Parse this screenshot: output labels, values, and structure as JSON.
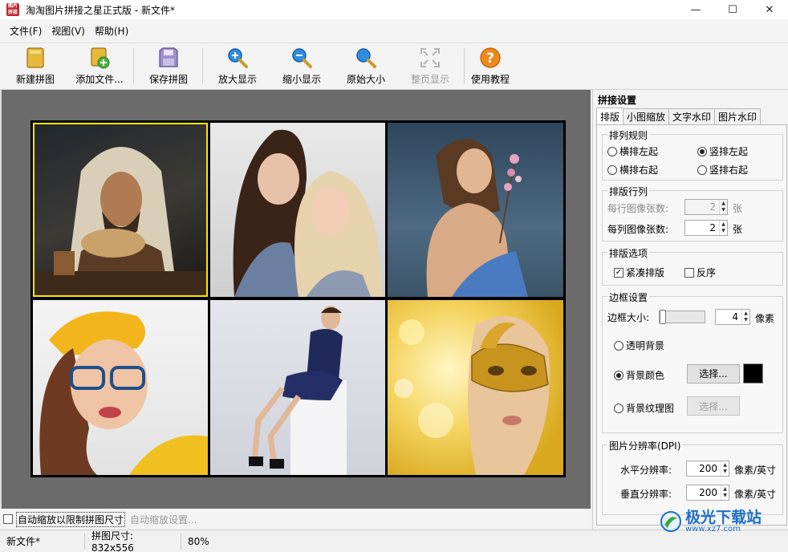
{
  "window": {
    "title": "淘淘图片拼接之星正式版 - 新文件*",
    "app_icon_text": "图片拼接",
    "minimize": "—",
    "maximize": "☐",
    "close": "✕"
  },
  "menu": [
    "文件(F)",
    "视图(V)",
    "帮助(H)"
  ],
  "toolbar": [
    {
      "label": "新建拼图",
      "icon": "new-mosaic-icon",
      "enabled": true
    },
    {
      "label": "添加文件...",
      "icon": "add-file-icon",
      "enabled": true
    },
    {
      "label": "保存拼图",
      "icon": "save-icon",
      "enabled": true
    },
    {
      "label": "放大显示",
      "icon": "zoom-in-icon",
      "enabled": true
    },
    {
      "label": "缩小显示",
      "icon": "zoom-out-icon",
      "enabled": true
    },
    {
      "label": "原始大小",
      "icon": "actual-size-icon",
      "enabled": true
    },
    {
      "label": "整页显示",
      "icon": "fit-page-icon",
      "enabled": false
    },
    {
      "label": "使用教程",
      "icon": "help-icon",
      "enabled": true
    }
  ],
  "canvas": {
    "tiles": [
      {
        "name": "tile-man-bread",
        "selected": true
      },
      {
        "name": "tile-two-women",
        "selected": false
      },
      {
        "name": "tile-woman-flowers",
        "selected": false
      },
      {
        "name": "tile-woman-glasses",
        "selected": false
      },
      {
        "name": "tile-woman-sitting",
        "selected": false
      },
      {
        "name": "tile-woman-mask",
        "selected": false
      }
    ]
  },
  "bottom": {
    "auto_scale_label": "自动缩放以限制拼图尺寸",
    "auto_scale_checked": false,
    "auto_scale_settings": "自动缩放设置..."
  },
  "status": {
    "file": "新文件*",
    "size": "拼图尺寸: 832x556",
    "zoom": "80%"
  },
  "panel": {
    "title": "拼接设置",
    "tabs": [
      "排版",
      "小图缩放",
      "文字水印",
      "图片水印"
    ],
    "active_tab": 0,
    "arrangement": {
      "title": "排列规则",
      "options": [
        {
          "label": "横排左起",
          "checked": false
        },
        {
          "label": "竖排左起",
          "checked": true
        },
        {
          "label": "横排右起",
          "checked": false
        },
        {
          "label": "竖排右起",
          "checked": false
        }
      ]
    },
    "rows_cols": {
      "title": "排版行列",
      "per_row_label": "每行图像张数:",
      "per_row_value": "2",
      "per_col_label": "每列图像张数:",
      "per_col_value": "2",
      "unit": "张"
    },
    "layout_options": {
      "title": "排版选项",
      "compact_label": "紧凑排版",
      "compact_checked": true,
      "reverse_label": "反序",
      "reverse_checked": false
    },
    "border": {
      "title": "边框设置",
      "size_label": "边框大小:",
      "size_value": "4",
      "size_unit": "像素",
      "transparent_label": "透明背景",
      "bgcolor_label": "背景颜色",
      "texture_label": "背景纹理图",
      "selected": "bgcolor",
      "choose_label": "选择...",
      "choose_texture_label": "选择...",
      "bg_color": "#000000"
    },
    "dpi": {
      "title": "图片分辨率(DPI)",
      "h_label": "水平分辨率:",
      "h_value": "200",
      "v_label": "垂直分辨率:",
      "v_value": "200",
      "unit": "像素/英寸"
    }
  },
  "watermark": {
    "text": "极光下载站",
    "url": "www.xz7.com"
  }
}
